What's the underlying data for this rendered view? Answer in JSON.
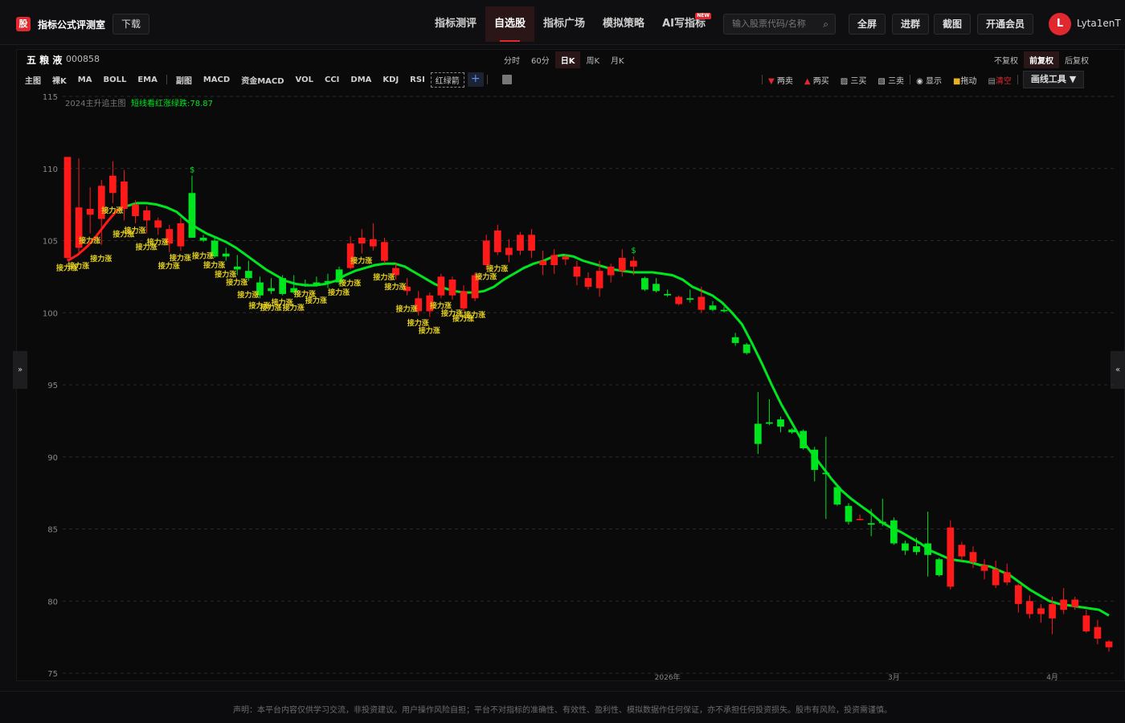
{
  "header": {
    "logo": "股",
    "app_name": "指标公式评测室",
    "download_label": "下载",
    "nav": [
      {
        "label": "指标测评",
        "active": false
      },
      {
        "label": "自选股",
        "active": true
      },
      {
        "label": "指标广场",
        "active": false
      },
      {
        "label": "模拟策略",
        "active": false
      },
      {
        "label": "AI写指标",
        "active": false,
        "badge": "NEW"
      }
    ],
    "search_placeholder": "输入股票代码/名称",
    "fullscreen_label": "全屏",
    "join_group_label": "进群",
    "screenshot_label": "截图",
    "vip_label": "开通会员",
    "avatar_letter": "L",
    "username": "Lyta1enT"
  },
  "stock": {
    "name": "五 粮 液",
    "code": "000858"
  },
  "periods": [
    {
      "label": "分时",
      "active": false
    },
    {
      "label": "60分",
      "active": false
    },
    {
      "label": "日K",
      "active": true
    },
    {
      "label": "周K",
      "active": false
    },
    {
      "label": "月K",
      "active": false
    }
  ],
  "adjust": [
    {
      "label": "不复权",
      "active": false
    },
    {
      "label": "前复权",
      "active": true
    },
    {
      "label": "后复权",
      "active": false
    }
  ],
  "indicators_main": [
    "主图",
    "裸K",
    "MA",
    "BOLL",
    "EMA"
  ],
  "indicators_sub": [
    "副图",
    "MACD",
    "资金MACD",
    "VOL",
    "CCI",
    "DMA",
    "KDJ",
    "RSI"
  ],
  "indicator_custom": "红绿箭",
  "tools": {
    "sell2": "两卖",
    "buy2": "两买",
    "buy3": "三买",
    "sell3": "三卖",
    "show": "显示",
    "drag": "拖动",
    "clear": "清空",
    "draw_tools": "画线工具 ▼"
  },
  "side_left": "»",
  "side_right": "«",
  "legend": {
    "main": "2024主升追主图",
    "line": "短线看红涨绿跌:78.87"
  },
  "disclaimer": "声明：本平台内容仅供学习交流，非投资建议。用户操作风险自担；平台不对指标的准确性、有效性、盈利性、模拟数据作任何保证，亦不承担任何投资损失。股市有风险，投资需谨慎。",
  "colors": {
    "up": "#ff1a1a",
    "down": "#00e61e",
    "signal": "#e6d21e",
    "bg": "#0a0a0b"
  },
  "chart_data": {
    "type": "candlestick",
    "ylim": [
      75,
      115
    ],
    "yticks": [
      75,
      80,
      85,
      90,
      95,
      100,
      105,
      110,
      115
    ],
    "xticks": [
      "2026年",
      "3月",
      "4月"
    ],
    "candles": [
      {
        "o": 103.8,
        "h": 110.8,
        "l": 103.6,
        "c": 110.8
      },
      {
        "o": 104.5,
        "h": 110.7,
        "l": 104.2,
        "c": 107.3
      },
      {
        "o": 106.8,
        "h": 108.7,
        "l": 105.5,
        "c": 107.2
      },
      {
        "o": 106.5,
        "h": 109.2,
        "l": 104.7,
        "c": 108.8
      },
      {
        "o": 108.3,
        "h": 110.5,
        "l": 107.6,
        "c": 109.5
      },
      {
        "o": 107.2,
        "h": 109.9,
        "l": 106.4,
        "c": 109.1
      },
      {
        "o": 106.7,
        "h": 107.8,
        "l": 106.2,
        "c": 107.5
      },
      {
        "o": 106.4,
        "h": 107.4,
        "l": 105.5,
        "c": 107.1
      },
      {
        "o": 105.9,
        "h": 106.6,
        "l": 105.4,
        "c": 106.4
      },
      {
        "o": 104.8,
        "h": 106.1,
        "l": 104.2,
        "c": 105.8
      },
      {
        "o": 104.6,
        "h": 106.6,
        "l": 104.3,
        "c": 106.2
      },
      {
        "o": 108.3,
        "h": 109.5,
        "l": 105.2,
        "c": 105.2
      },
      {
        "o": 105.2,
        "h": 105.4,
        "l": 104.9,
        "c": 105.0
      },
      {
        "o": 105.0,
        "h": 105.3,
        "l": 103.8,
        "c": 103.9
      },
      {
        "o": 104.1,
        "h": 104.5,
        "l": 103.6,
        "c": 103.9
      },
      {
        "o": 103.2,
        "h": 104.0,
        "l": 102.6,
        "c": 103.0
      },
      {
        "o": 102.9,
        "h": 103.6,
        "l": 102.2,
        "c": 102.4
      },
      {
        "o": 102.1,
        "h": 102.5,
        "l": 101.0,
        "c": 101.2
      },
      {
        "o": 101.7,
        "h": 102.4,
        "l": 101.3,
        "c": 101.5
      },
      {
        "o": 102.4,
        "h": 102.6,
        "l": 101.2,
        "c": 101.3
      },
      {
        "o": 101.7,
        "h": 102.6,
        "l": 101.3,
        "c": 101.4
      },
      {
        "o": 102.0,
        "h": 102.3,
        "l": 101.8,
        "c": 101.9
      },
      {
        "o": 102.1,
        "h": 102.5,
        "l": 101.8,
        "c": 101.9
      },
      {
        "o": 102.2,
        "h": 102.7,
        "l": 101.7,
        "c": 102.1
      },
      {
        "o": 103.0,
        "h": 103.2,
        "l": 101.9,
        "c": 102.1
      },
      {
        "o": 103.1,
        "h": 105.3,
        "l": 103.0,
        "c": 104.8
      },
      {
        "o": 104.8,
        "h": 105.8,
        "l": 104.1,
        "c": 105.2
      },
      {
        "o": 104.6,
        "h": 106.2,
        "l": 104.3,
        "c": 105.1
      },
      {
        "o": 103.6,
        "h": 105.2,
        "l": 103.4,
        "c": 104.9
      },
      {
        "o": 102.6,
        "h": 103.4,
        "l": 102.3,
        "c": 103.1
      },
      {
        "o": 101.5,
        "h": 102.4,
        "l": 101.2,
        "c": 101.8
      },
      {
        "o": 100.1,
        "h": 101.5,
        "l": 99.8,
        "c": 101.0
      },
      {
        "o": 100.1,
        "h": 101.4,
        "l": 99.7,
        "c": 101.2
      },
      {
        "o": 101.2,
        "h": 102.7,
        "l": 101.0,
        "c": 102.5
      },
      {
        "o": 101.2,
        "h": 102.5,
        "l": 100.9,
        "c": 102.3
      },
      {
        "o": 100.3,
        "h": 101.9,
        "l": 100.1,
        "c": 101.5
      },
      {
        "o": 101.0,
        "h": 102.8,
        "l": 100.8,
        "c": 102.6
      },
      {
        "o": 103.3,
        "h": 105.4,
        "l": 103.0,
        "c": 105.0
      },
      {
        "o": 104.2,
        "h": 106.1,
        "l": 104.0,
        "c": 105.7
      },
      {
        "o": 104.0,
        "h": 105.1,
        "l": 103.5,
        "c": 104.5
      },
      {
        "o": 104.3,
        "h": 105.6,
        "l": 104.0,
        "c": 105.4
      },
      {
        "o": 104.3,
        "h": 105.8,
        "l": 103.8,
        "c": 105.4
      },
      {
        "o": 103.3,
        "h": 104.3,
        "l": 102.6,
        "c": 103.6
      },
      {
        "o": 103.3,
        "h": 104.4,
        "l": 102.7,
        "c": 104.0
      },
      {
        "o": 103.7,
        "h": 104.0,
        "l": 103.3,
        "c": 103.9
      },
      {
        "o": 102.5,
        "h": 103.6,
        "l": 101.9,
        "c": 103.2
      },
      {
        "o": 101.8,
        "h": 102.8,
        "l": 101.6,
        "c": 102.4
      },
      {
        "o": 101.7,
        "h": 103.6,
        "l": 101.1,
        "c": 102.9
      },
      {
        "o": 102.6,
        "h": 103.4,
        "l": 102.1,
        "c": 103.2
      },
      {
        "o": 102.9,
        "h": 104.4,
        "l": 102.5,
        "c": 103.8
      },
      {
        "o": 103.2,
        "h": 103.9,
        "l": 102.6,
        "c": 103.6
      },
      {
        "o": 102.4,
        "h": 102.5,
        "l": 101.5,
        "c": 101.6
      },
      {
        "o": 102.0,
        "h": 102.4,
        "l": 101.4,
        "c": 101.5
      },
      {
        "o": 101.3,
        "h": 101.6,
        "l": 101.1,
        "c": 101.2
      },
      {
        "o": 100.6,
        "h": 101.2,
        "l": 100.5,
        "c": 101.1
      },
      {
        "o": 101.0,
        "h": 101.6,
        "l": 100.7,
        "c": 100.9
      },
      {
        "o": 100.2,
        "h": 101.8,
        "l": 100.0,
        "c": 101.1
      },
      {
        "o": 100.5,
        "h": 100.8,
        "l": 100.1,
        "c": 100.2
      },
      {
        "o": 100.2,
        "h": 100.4,
        "l": 100.0,
        "c": 100.1
      },
      {
        "o": 98.3,
        "h": 98.6,
        "l": 97.7,
        "c": 97.9
      },
      {
        "o": 97.8,
        "h": 97.9,
        "l": 97.1,
        "c": 97.2
      },
      {
        "o": 92.3,
        "h": 94.5,
        "l": 90.2,
        "c": 90.9
      },
      {
        "o": 92.4,
        "h": 94.0,
        "l": 92.2,
        "c": 92.3
      },
      {
        "o": 92.6,
        "h": 92.8,
        "l": 91.7,
        "c": 92.1
      },
      {
        "o": 91.9,
        "h": 92.0,
        "l": 91.6,
        "c": 91.7
      },
      {
        "o": 91.8,
        "h": 91.9,
        "l": 90.5,
        "c": 90.6
      },
      {
        "o": 90.5,
        "h": 90.7,
        "l": 88.3,
        "c": 89.1
      },
      {
        "o": 88.9,
        "h": 91.4,
        "l": 85.7,
        "c": 88.8
      },
      {
        "o": 87.9,
        "h": 88.1,
        "l": 86.6,
        "c": 86.7
      },
      {
        "o": 86.6,
        "h": 86.8,
        "l": 85.3,
        "c": 85.5
      },
      {
        "o": 85.7,
        "h": 86.0,
        "l": 85.6,
        "c": 85.7
      },
      {
        "o": 85.4,
        "h": 86.4,
        "l": 84.5,
        "c": 85.3
      },
      {
        "o": 85.5,
        "h": 87.1,
        "l": 85.2,
        "c": 85.4
      },
      {
        "o": 85.6,
        "h": 85.8,
        "l": 83.9,
        "c": 84.0
      },
      {
        "o": 84.0,
        "h": 84.2,
        "l": 83.2,
        "c": 83.5
      },
      {
        "o": 83.8,
        "h": 84.4,
        "l": 83.2,
        "c": 83.4
      },
      {
        "o": 84.0,
        "h": 86.2,
        "l": 81.7,
        "c": 83.2
      },
      {
        "o": 82.9,
        "h": 83.0,
        "l": 81.7,
        "c": 81.8
      },
      {
        "o": 81.0,
        "h": 85.6,
        "l": 80.8,
        "c": 85.1
      },
      {
        "o": 83.1,
        "h": 84.1,
        "l": 82.8,
        "c": 83.9
      },
      {
        "o": 82.7,
        "h": 83.8,
        "l": 82.3,
        "c": 83.4
      },
      {
        "o": 82.1,
        "h": 82.9,
        "l": 81.5,
        "c": 82.5
      },
      {
        "o": 81.1,
        "h": 82.8,
        "l": 80.9,
        "c": 82.2
      },
      {
        "o": 81.3,
        "h": 82.6,
        "l": 81.1,
        "c": 82.0
      },
      {
        "o": 79.8,
        "h": 81.2,
        "l": 79.2,
        "c": 81.1
      },
      {
        "o": 79.1,
        "h": 80.4,
        "l": 78.8,
        "c": 80.0
      },
      {
        "o": 79.1,
        "h": 79.8,
        "l": 78.5,
        "c": 79.5
      },
      {
        "o": 78.8,
        "h": 80.3,
        "l": 77.7,
        "c": 79.8
      },
      {
        "o": 79.4,
        "h": 80.9,
        "l": 79.1,
        "c": 80.1
      },
      {
        "o": 79.6,
        "h": 80.3,
        "l": 79.4,
        "c": 80.1
      },
      {
        "o": 77.9,
        "h": 79.4,
        "l": 77.8,
        "c": 79.0
      },
      {
        "o": 77.4,
        "h": 78.7,
        "l": 77.0,
        "c": 78.2
      },
      {
        "o": 76.8,
        "h": 77.3,
        "l": 76.5,
        "c": 77.2
      }
    ],
    "trend_line": [
      103.6,
      104.0,
      104.6,
      105.4,
      106.3,
      107.1,
      107.4,
      107.6,
      107.6,
      107.5,
      107.3,
      107.0,
      106.4,
      105.9,
      105.5,
      105.2,
      104.9,
      104.5,
      104.0,
      103.5,
      103.0,
      102.6,
      102.2,
      102.0,
      101.9,
      101.9,
      102.0,
      102.2,
      102.6,
      102.9,
      103.1,
      103.3,
      103.4,
      103.4,
      103.2,
      102.8,
      102.4,
      102.0,
      101.7,
      101.5,
      101.4,
      101.4,
      101.5,
      101.8,
      102.3,
      102.7,
      103.1,
      103.4,
      103.6,
      103.9,
      104.0,
      103.9,
      103.6,
      103.4,
      103.2,
      103.0,
      102.9,
      102.8,
      102.8,
      102.8,
      102.7,
      102.6,
      102.3,
      101.8,
      101.5,
      101.2,
      100.7,
      100.0,
      99.2,
      97.9,
      96.5,
      95.0,
      93.6,
      92.4,
      91.2,
      90.3,
      89.4,
      88.5,
      87.7,
      87.1,
      86.6,
      86.1,
      85.5,
      85.1,
      84.8,
      84.4,
      84.0,
      83.5,
      83.2,
      82.9,
      82.8,
      82.7,
      82.5,
      82.4,
      82.1,
      81.8,
      81.3,
      80.8,
      80.4,
      80.0,
      79.8,
      79.7,
      79.6,
      79.5,
      79.4,
      79.0
    ],
    "trend_colors": [
      "red_until_index",
      6,
      "green_from_index",
      6
    ],
    "signal_label": "接力涨",
    "signal_up_marks": 36,
    "dollar_marks": [
      "$",
      "$"
    ]
  }
}
